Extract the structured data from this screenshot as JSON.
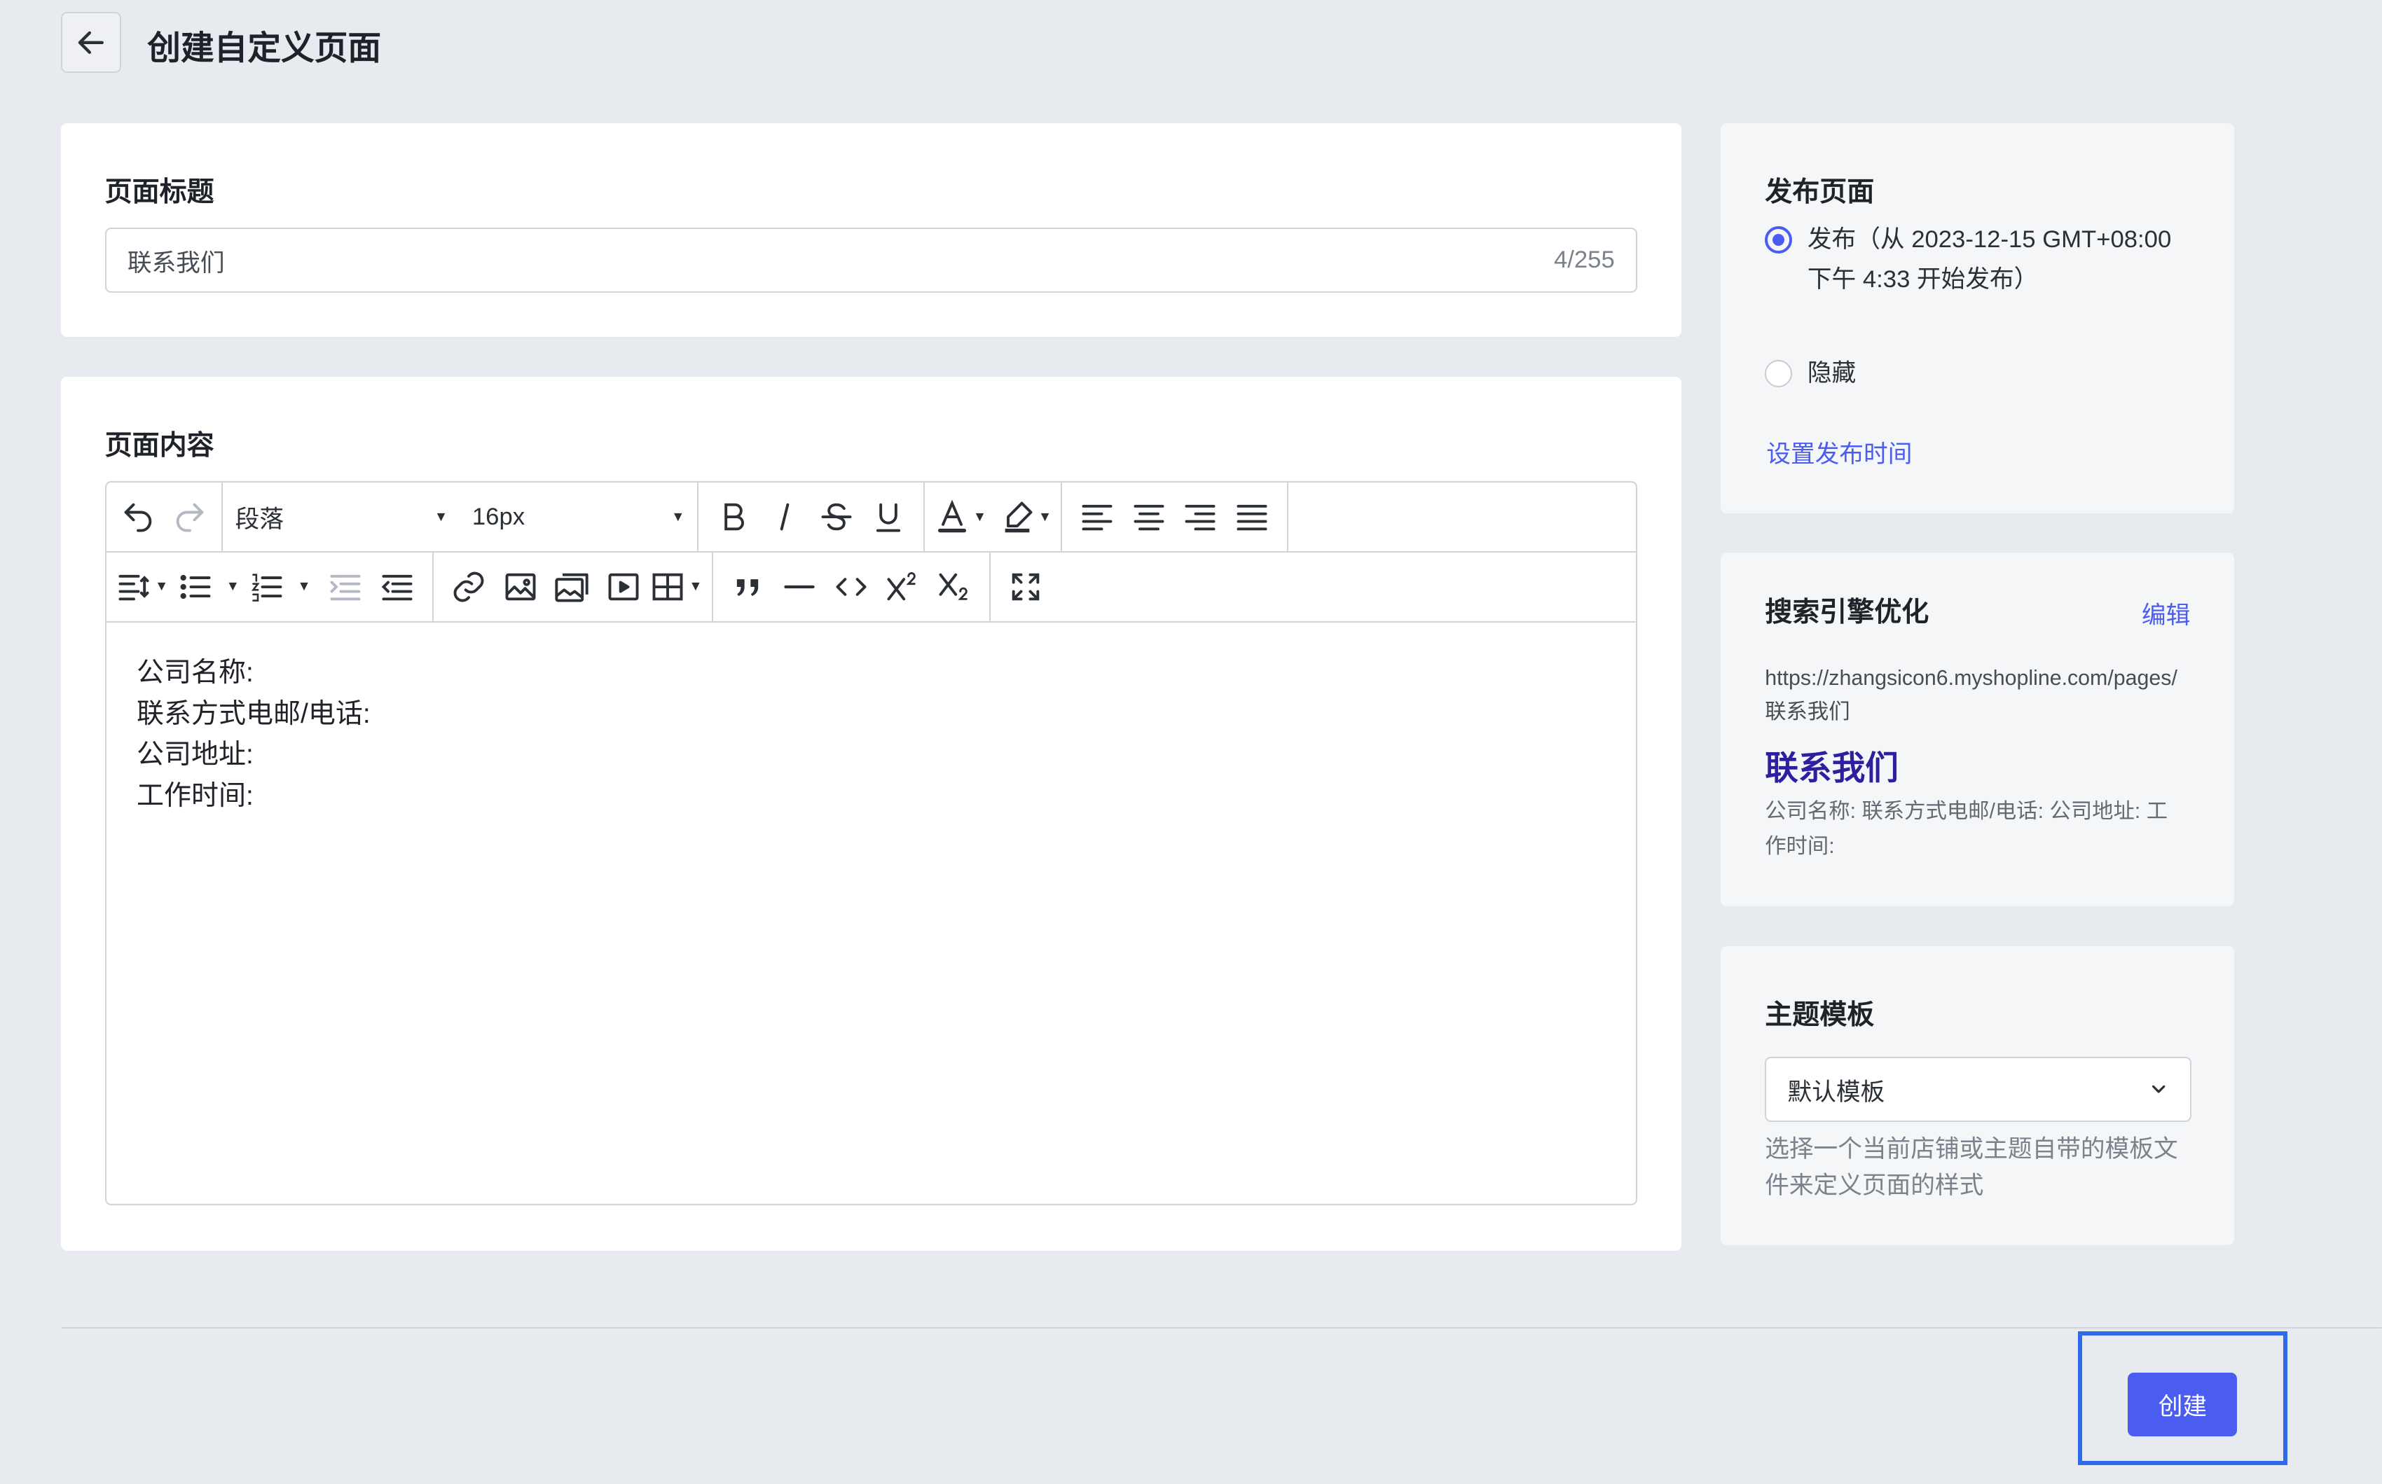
{
  "header": {
    "title": "创建自定义页面"
  },
  "page_title_card": {
    "label": "页面标题",
    "value": "联系我们",
    "count": "4/255"
  },
  "content_card": {
    "label": "页面内容",
    "paragraph_select": "段落",
    "font_size_select": "16px",
    "body_lines": [
      "公司名称:",
      "联系方式电邮/电话:",
      "公司地址:",
      "工作时间:"
    ]
  },
  "publish_card": {
    "title": "发布页面",
    "option_publish": "发布（从 2023-12-15 GMT+08:00 下午 4:33 开始发布）",
    "option_hide": "隐藏",
    "set_time_link": "设置发布时间"
  },
  "seo_card": {
    "title": "搜索引擎优化",
    "edit_link": "编辑",
    "url": "https://zhangsicon6.myshopline.com/pages/联系我们",
    "preview_title": "联系我们",
    "preview_desc": "公司名称: 联系方式电邮/电话: 公司地址: 工作时间:"
  },
  "template_card": {
    "title": "主题模板",
    "selected": "默认模板",
    "hint": "选择一个当前店铺或主题自带的模板文件来定义页面的样式"
  },
  "footer": {
    "create_label": "创建"
  },
  "colors": {
    "accent": "#4b5cf0",
    "seo_title": "#2e1f9e",
    "highlight": "#2f6be8"
  }
}
